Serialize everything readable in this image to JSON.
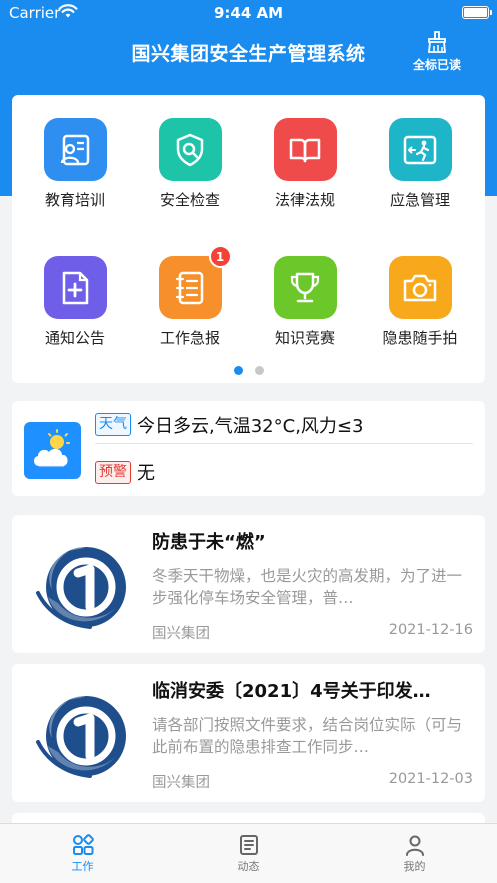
{
  "status_bar": {
    "carrier": "Carrier",
    "time": "9:44 AM",
    "battery_level": 1.0
  },
  "header": {
    "title": "国兴集团安全生产管理系统",
    "read_all_label": "全标已读"
  },
  "menu": {
    "items": [
      {
        "label": "教育培训",
        "icon": "training-icon",
        "color": "#2f8ff0"
      },
      {
        "label": "安全检查",
        "icon": "shield-search-icon",
        "color": "#1ec4a8"
      },
      {
        "label": "法律法规",
        "icon": "book-icon",
        "color": "#ef4b4b"
      },
      {
        "label": "应急管理",
        "icon": "emergency-exit-icon",
        "color": "#1fb5c9"
      },
      {
        "label": "通知公告",
        "icon": "document-add-icon",
        "color": "#6f5fe8"
      },
      {
        "label": "工作急报",
        "icon": "notebook-icon",
        "color": "#f7902a",
        "badge": "1"
      },
      {
        "label": "知识竞赛",
        "icon": "trophy-icon",
        "color": "#6cc72b"
      },
      {
        "label": "隐患随手拍",
        "icon": "camera-icon",
        "color": "#f7a81b"
      }
    ],
    "page_count": 2,
    "current_page": 1
  },
  "weather": {
    "weather_tag": "天气",
    "weather_text": "今日多云,气温32°C,风力≤3",
    "warning_tag": "预警",
    "warning_text": "无"
  },
  "news": [
    {
      "title": "防患于未“燃”",
      "summary": "  冬季天干物燥，也是火灾的高发期，为了进一步强化停车场安全管理，普…",
      "source": "国兴集团",
      "date": "2021-12-16"
    },
    {
      "title": "临消安委〔2021〕4号关于印发…",
      "summary": "请各部门按照文件要求，结合岗位实际（可与此前布置的隐患排查工作同步…",
      "source": "国兴集团",
      "date": "2021-12-03"
    }
  ],
  "tabs": [
    {
      "label": "工作",
      "icon": "grid-icon",
      "active": true
    },
    {
      "label": "动态",
      "icon": "news-icon",
      "active": false
    },
    {
      "label": "我的",
      "icon": "person-icon",
      "active": false
    }
  ]
}
